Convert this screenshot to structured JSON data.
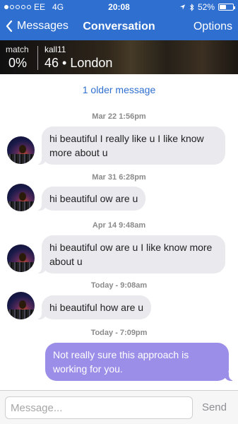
{
  "status_bar": {
    "carrier": "EE",
    "network": "4G",
    "time": "20:08",
    "battery": "52%",
    "battery_level": 0.52,
    "signal_bars_filled": 1,
    "signal_bars_total": 5,
    "icons": [
      "location-arrow-icon",
      "bluetooth-icon",
      "battery-icon"
    ]
  },
  "nav": {
    "back_label": "Messages",
    "title": "Conversation",
    "options_label": "Options"
  },
  "profile": {
    "match_label": "match",
    "match_value": "0%",
    "username": "kall11",
    "details": "46 • London"
  },
  "older_link": "1 older message",
  "thread": [
    {
      "timestamp": "Mar 22 1:56pm",
      "direction": "in",
      "text": "hi beautiful I really like u I like know more about u"
    },
    {
      "timestamp": "Mar 31 6:28pm",
      "direction": "in",
      "text": "hi beautiful ow are u"
    },
    {
      "timestamp": "Apr 14 9:48am",
      "direction": "in",
      "text": "hi beautiful ow are u I like know more about u"
    },
    {
      "timestamp": "Today - 9:08am",
      "direction": "in",
      "text": "hi beautiful how are u"
    },
    {
      "timestamp": "Today - 7:09pm",
      "direction": "out",
      "text": "Not really sure this approach is working for you."
    }
  ],
  "composer": {
    "placeholder": "Message...",
    "send_label": "Send"
  },
  "colors": {
    "header_blue": "#2f6fd0",
    "incoming_bubble": "#e9e9ee",
    "outgoing_bubble": "#9b8ee8"
  }
}
